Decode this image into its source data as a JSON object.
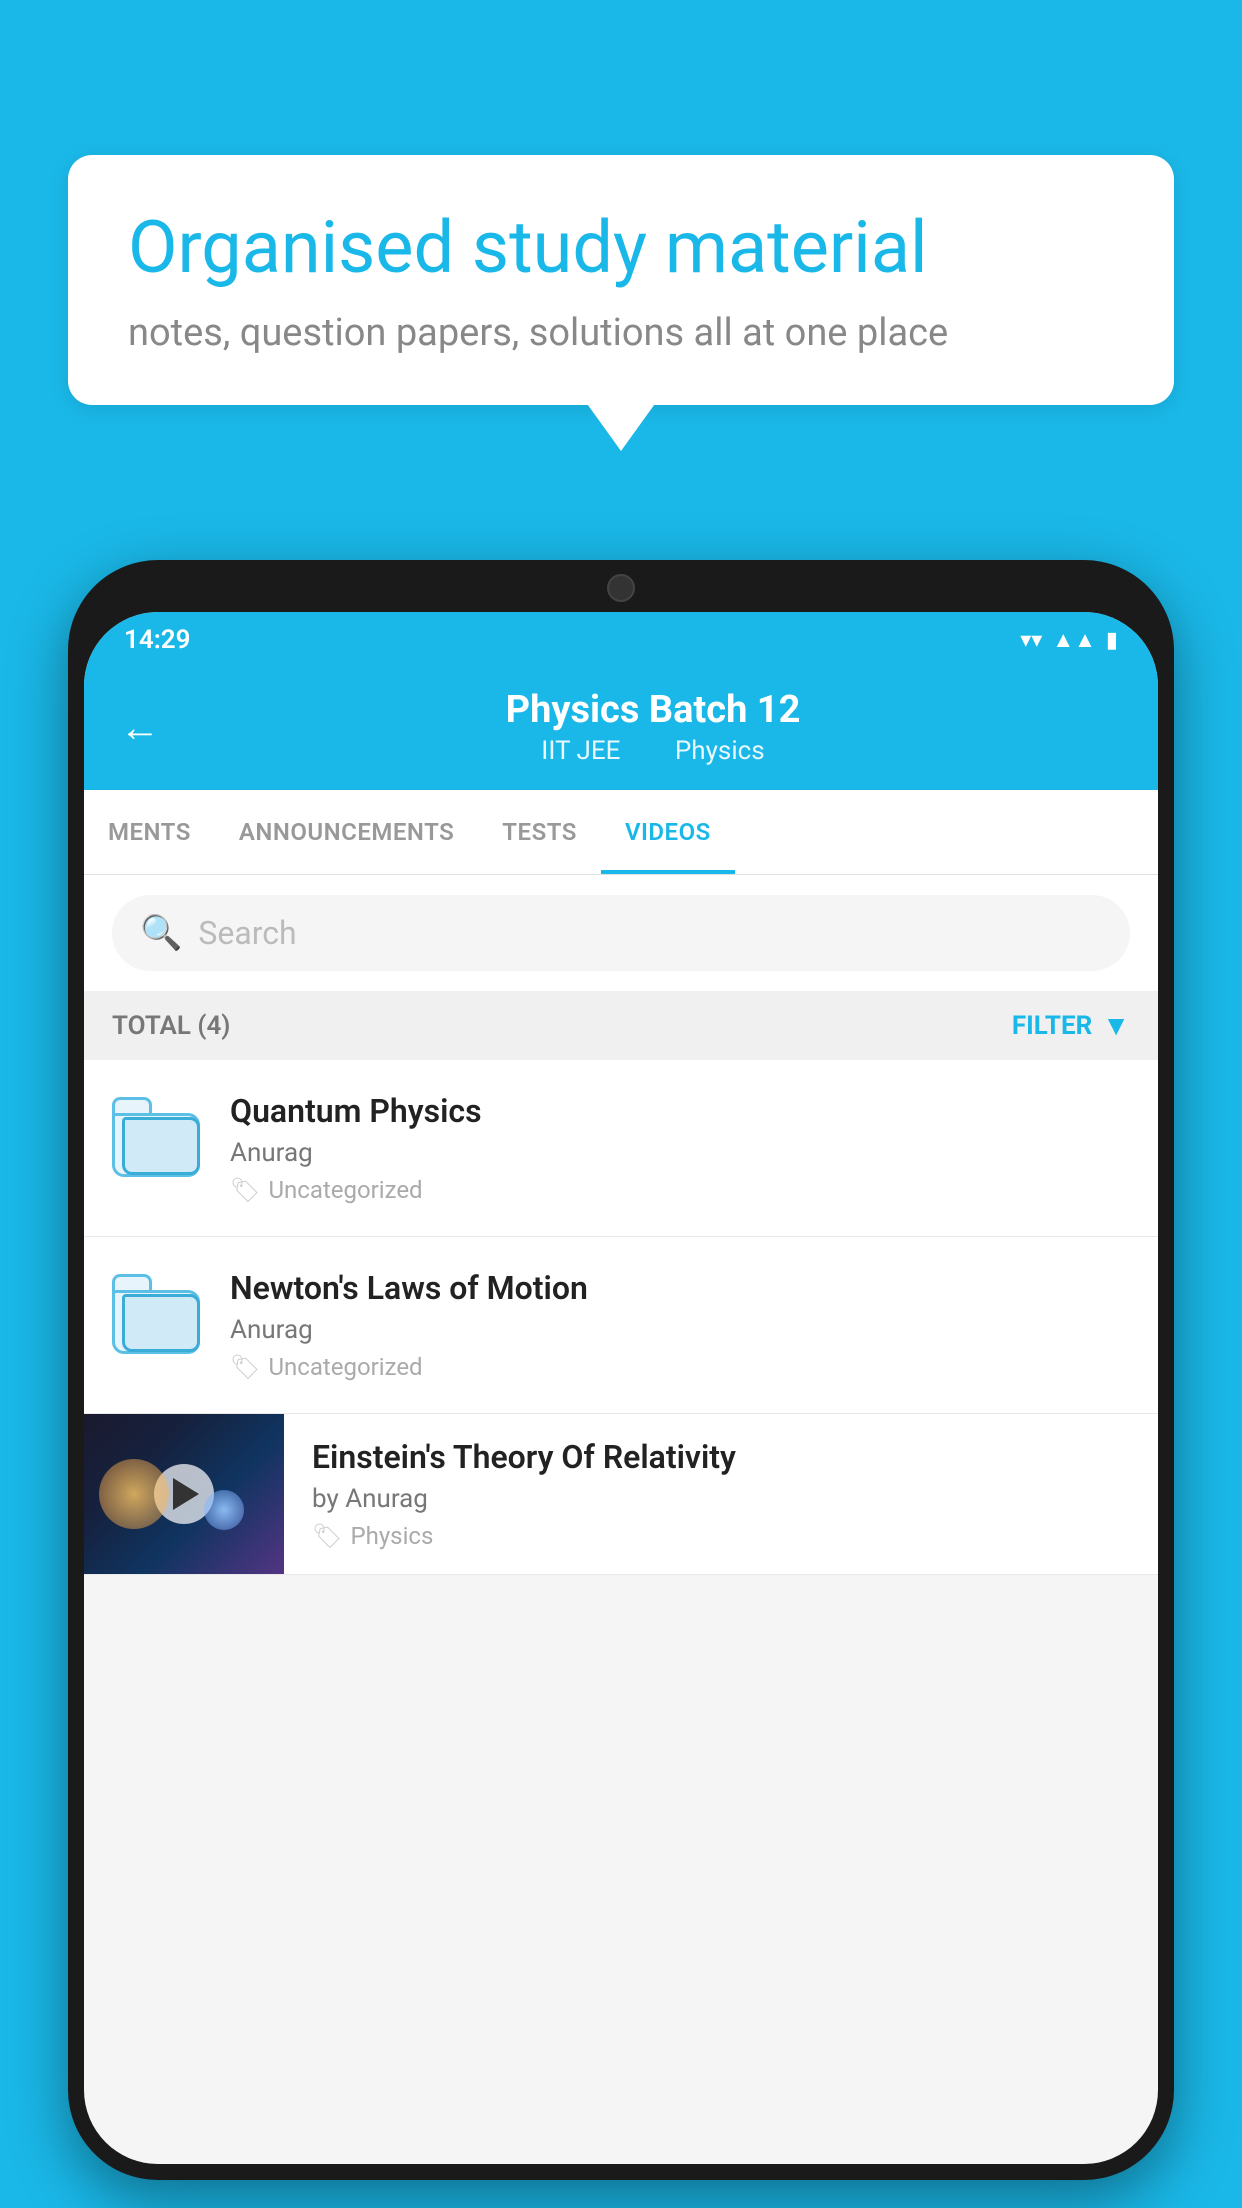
{
  "background_color": "#1ab8e8",
  "speech_bubble": {
    "title": "Organised study material",
    "subtitle": "notes, question papers, solutions all at one place"
  },
  "phone": {
    "status_bar": {
      "time": "14:29"
    },
    "header": {
      "title": "Physics Batch 12",
      "subtitle1": "IIT JEE",
      "subtitle2": "Physics",
      "back_label": "←"
    },
    "tabs": [
      {
        "label": "MENTS",
        "active": false
      },
      {
        "label": "ANNOUNCEMENTS",
        "active": false
      },
      {
        "label": "TESTS",
        "active": false
      },
      {
        "label": "VIDEOS",
        "active": true
      }
    ],
    "search": {
      "placeholder": "Search"
    },
    "filter": {
      "total_label": "TOTAL (4)",
      "filter_label": "FILTER"
    },
    "videos": [
      {
        "title": "Quantum Physics",
        "author": "Anurag",
        "tag": "Uncategorized",
        "has_thumbnail": false
      },
      {
        "title": "Newton's Laws of Motion",
        "author": "Anurag",
        "tag": "Uncategorized",
        "has_thumbnail": false
      },
      {
        "title": "Einstein's Theory Of Relativity",
        "author": "by Anurag",
        "tag": "Physics",
        "has_thumbnail": true
      }
    ]
  }
}
